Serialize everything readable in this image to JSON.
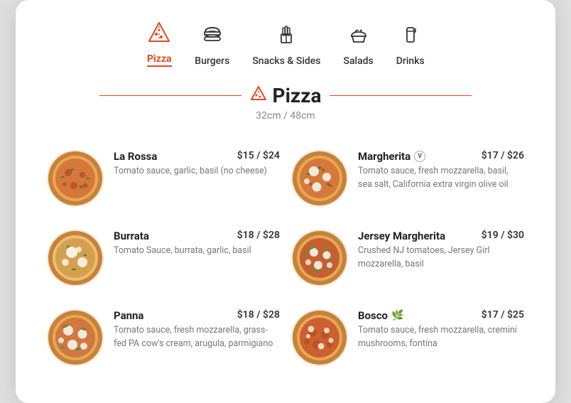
{
  "nav": {
    "items": [
      {
        "id": "pizza",
        "label": "Pizza",
        "active": true,
        "icon": "pizza"
      },
      {
        "id": "burgers",
        "label": "Burgers",
        "active": false,
        "icon": "burger"
      },
      {
        "id": "snacks",
        "label": "Snacks & Sides",
        "active": false,
        "icon": "fries"
      },
      {
        "id": "salads",
        "label": "Salads",
        "active": false,
        "icon": "salad"
      },
      {
        "id": "drinks",
        "label": "Drinks",
        "active": false,
        "icon": "drink"
      }
    ]
  },
  "section": {
    "title": "Pizza",
    "subtitle": "32cm / 48cm"
  },
  "menu_items": [
    {
      "id": "la-rossa",
      "name": "La Rossa",
      "price": "$15 / $24",
      "description": "Tomato sauce, garlic, basil (no cheese)",
      "badge": null,
      "col": 0
    },
    {
      "id": "margherita",
      "name": "Margherita",
      "price": "$17 / $26",
      "description": "Tomato sauce, fresh mozzarella, basil, sea salt, California extra virgin olive oil",
      "badge": "V",
      "col": 1
    },
    {
      "id": "burrata",
      "name": "Burrata",
      "price": "$18 / $28",
      "description": "Tomato Sauce, burrata, garlic, basil",
      "badge": null,
      "col": 0
    },
    {
      "id": "jersey-margherita",
      "name": "Jersey Margherita",
      "price": "$19 / $30",
      "description": "Crushed NJ tomatoes, Jersey Girl mozzarella, basil",
      "badge": null,
      "col": 1
    },
    {
      "id": "panna",
      "name": "Panna",
      "price": "$18 / $28",
      "description": "Tomato sauce, fresh mozzarella, grass-fed PA cow's cream, arugula, parmigiano",
      "badge": null,
      "col": 0
    },
    {
      "id": "bosco",
      "name": "Bosco",
      "price": "$17 / $25",
      "description": "Tomato sauce, fresh mozzarella, cremini mushrooms, fontina",
      "badge": "leaf",
      "col": 1
    }
  ]
}
